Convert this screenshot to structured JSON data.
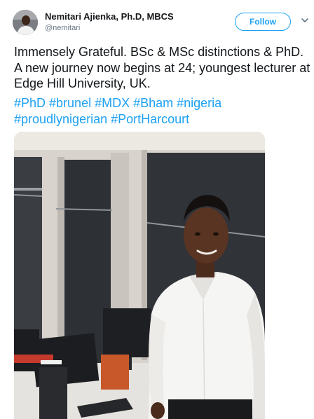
{
  "author": {
    "name": "Nemitari Ajienka, Ph.D, MBCS",
    "handle": "@nemitari"
  },
  "follow_label": "Follow",
  "tweet": {
    "text": "Immensely Grateful. BSc & MSc distinctions & PhD. A new journey now begins at 24; youngest lecturer at Edge Hill University, UK.",
    "hashtags": [
      "#PhD",
      "#brunel",
      "#MDX",
      "#Bham",
      "#nigeria",
      "#proudlynigerian",
      "#PortHarcourt"
    ]
  },
  "colors": {
    "accent": "#1da1f2",
    "text": "#14171a",
    "secondary": "#657786"
  },
  "icons": {
    "more": "chevron-down-icon"
  }
}
